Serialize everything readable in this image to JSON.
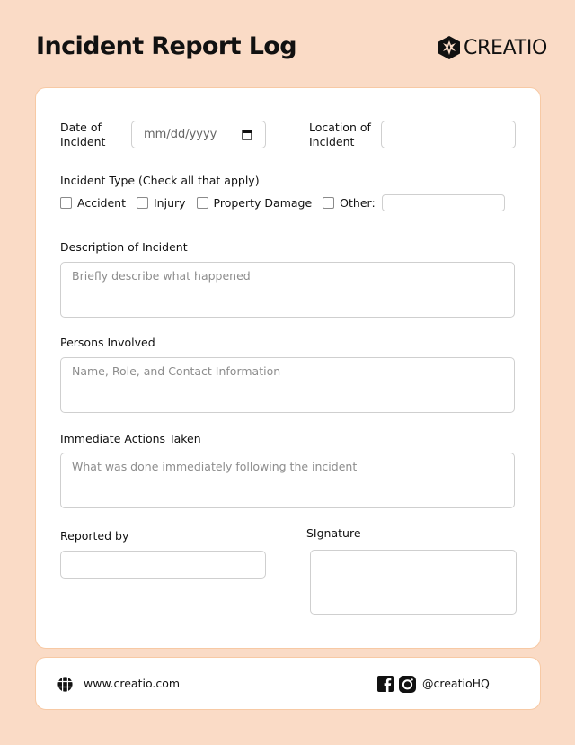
{
  "header": {
    "title": "Incident Report Log",
    "brand": "CREATIO",
    "brand_icon": "creatio-logo-icon"
  },
  "form": {
    "date": {
      "label_line1": "Date of",
      "label_line2": "Incident",
      "placeholder": "mm/dd/yyyy",
      "icon": "calendar-icon"
    },
    "location": {
      "label_line1": "Location of",
      "label_line2": "Incident",
      "value": ""
    },
    "incident_type": {
      "label": "Incident Type (Check all that apply)",
      "options": [
        {
          "label": "Accident",
          "checked": false
        },
        {
          "label": "Injury",
          "checked": false
        },
        {
          "label": "Property Damage",
          "checked": false
        },
        {
          "label": "Other:",
          "checked": false
        }
      ],
      "other_value": ""
    },
    "description": {
      "label": "Description of Incident",
      "placeholder": "Briefly describe what happened"
    },
    "persons": {
      "label": "Persons Involved",
      "placeholder": "Name, Role, and Contact Information"
    },
    "actions": {
      "label": "Immediate Actions Taken",
      "placeholder": "What was done immediately following the incident"
    },
    "reported_by": {
      "label": "Reported by",
      "value": ""
    },
    "signature": {
      "label": "SIgnature",
      "value": ""
    }
  },
  "footer": {
    "website": "www.creatio.com",
    "website_icon": "globe-icon",
    "social_icons": [
      "facebook-icon",
      "instagram-icon"
    ],
    "handle": "@creatioHQ"
  },
  "colors": {
    "background": "#fadbc6",
    "card": "#ffffff",
    "card_border": "#f7c9a4",
    "input_border": "#cfcfcf",
    "placeholder": "#8d8d8d",
    "text": "#111111"
  }
}
